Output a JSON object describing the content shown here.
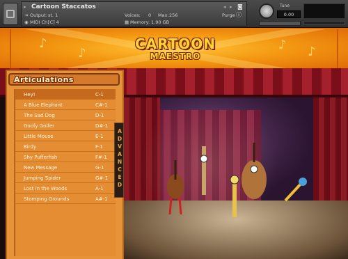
{
  "header": {
    "instrument_title": "Cartoon Staccatos",
    "output_label": "Output:",
    "output_value": "st. 1",
    "voices_label": "Voices:",
    "voices_value": "0",
    "max_label": "Max:",
    "max_value": "256",
    "purge_label": "Purge",
    "midi_label": "MIDI Ch:",
    "midi_value": "[C] 4",
    "memory_label": "Memory:",
    "memory_value": "1.90 GB",
    "tune_label": "Tune",
    "tune_value": "0.00"
  },
  "banner": {
    "logo_line1": "CARTOON",
    "logo_line2": "MAESTRO"
  },
  "articulations": {
    "title": "Articulations",
    "items": [
      {
        "label": "Hey!",
        "key": "C-1",
        "selected": true
      },
      {
        "label": "A Blue Elephant",
        "key": "C#-1"
      },
      {
        "label": "The Sad Dog",
        "key": "D-1"
      },
      {
        "label": "Goofy Golfer",
        "key": "D#-1"
      },
      {
        "label": "Little Mouse",
        "key": "E-1"
      },
      {
        "label": "Birdy",
        "key": "F-1"
      },
      {
        "label": "Shy Pufferfish",
        "key": "F#-1"
      },
      {
        "label": "New Message",
        "key": "G-1"
      },
      {
        "label": "Jumping Spider",
        "key": "G#-1"
      },
      {
        "label": "Lost in the Woods",
        "key": "A-1"
      },
      {
        "label": "Stomping Grounds",
        "key": "A#-1"
      }
    ],
    "advanced_label": "ADVANCED"
  },
  "colors": {
    "banner_orange": "#f49a12",
    "panel_orange": "#e7933a",
    "curtain_red": "#a3202c"
  }
}
